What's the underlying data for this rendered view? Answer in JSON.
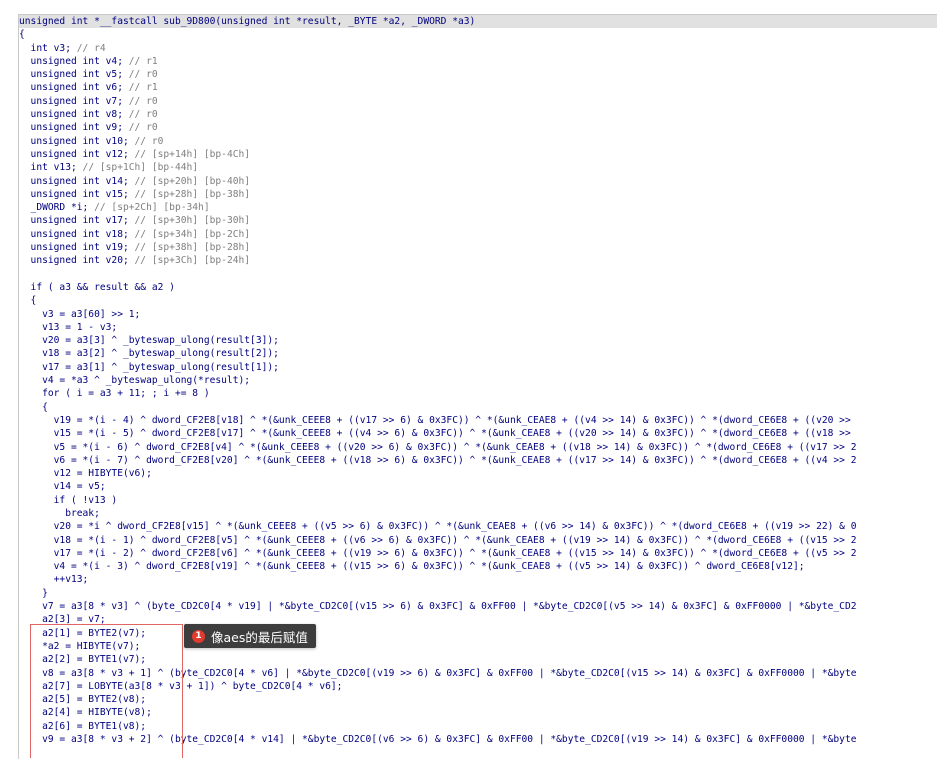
{
  "code": {
    "lines": [
      "unsigned int *__fastcall sub_9D800(unsigned int *result, _BYTE *a2, _DWORD *a3)",
      "{",
      "  int v3; // r4",
      "  unsigned int v4; // r1",
      "  unsigned int v5; // r0",
      "  unsigned int v6; // r1",
      "  unsigned int v7; // r0",
      "  unsigned int v8; // r0",
      "  unsigned int v9; // r0",
      "  unsigned int v10; // r0",
      "  unsigned int v12; // [sp+14h] [bp-4Ch]",
      "  int v13; // [sp+1Ch] [bp-44h]",
      "  unsigned int v14; // [sp+20h] [bp-40h]",
      "  unsigned int v15; // [sp+28h] [bp-38h]",
      "  _DWORD *i; // [sp+2Ch] [bp-34h]",
      "  unsigned int v17; // [sp+30h] [bp-30h]",
      "  unsigned int v18; // [sp+34h] [bp-2Ch]",
      "  unsigned int v19; // [sp+38h] [bp-28h]",
      "  unsigned int v20; // [sp+3Ch] [bp-24h]",
      "",
      "  if ( a3 && result && a2 )",
      "  {",
      "    v3 = a3[60] >> 1;",
      "    v13 = 1 - v3;",
      "    v20 = a3[3] ^ _byteswap_ulong(result[3]);",
      "    v18 = a3[2] ^ _byteswap_ulong(result[2]);",
      "    v17 = a3[1] ^ _byteswap_ulong(result[1]);",
      "    v4 = *a3 ^ _byteswap_ulong(*result);",
      "    for ( i = a3 + 11; ; i += 8 )",
      "    {",
      "      v19 = *(i - 4) ^ dword_CF2E8[v18] ^ *(&unk_CEEE8 + ((v17 >> 6) & 0x3FC)) ^ *(&unk_CEAE8 + ((v4 >> 14) & 0x3FC)) ^ *(dword_CE6E8 + ((v20 >>",
      "      v15 = *(i - 5) ^ dword_CF2E8[v17] ^ *(&unk_CEEE8 + ((v4 >> 6) & 0x3FC)) ^ *(&unk_CEAE8 + ((v20 >> 14) & 0x3FC)) ^ *(dword_CE6E8 + ((v18 >>",
      "      v5 = *(i - 6) ^ dword_CF2E8[v4] ^ *(&unk_CEEE8 + ((v20 >> 6) & 0x3FC)) ^ *(&unk_CEAE8 + ((v18 >> 14) & 0x3FC)) ^ *(dword_CE6E8 + ((v17 >> 2",
      "      v6 = *(i - 7) ^ dword_CF2E8[v20] ^ *(&unk_CEEE8 + ((v18 >> 6) & 0x3FC)) ^ *(&unk_CEAE8 + ((v17 >> 14) & 0x3FC)) ^ *(dword_CE6E8 + ((v4 >> 2",
      "      v12 = HIBYTE(v6);",
      "      v14 = v5;",
      "      if ( !v13 )",
      "        break;",
      "      v20 = *i ^ dword_CF2E8[v15] ^ *(&unk_CEEE8 + ((v5 >> 6) & 0x3FC)) ^ *(&unk_CEAE8 + ((v6 >> 14) & 0x3FC)) ^ *(dword_CE6E8 + ((v19 >> 22) & 0",
      "      v18 = *(i - 1) ^ dword_CF2E8[v5] ^ *(&unk_CEEE8 + ((v6 >> 6) & 0x3FC)) ^ *(&unk_CEAE8 + ((v19 >> 14) & 0x3FC)) ^ *(dword_CE6E8 + ((v15 >> 2",
      "      v17 = *(i - 2) ^ dword_CF2E8[v6] ^ *(&unk_CEEE8 + ((v19 >> 6) & 0x3FC)) ^ *(&unk_CEAE8 + ((v15 >> 14) & 0x3FC)) ^ *(dword_CE6E8 + ((v5 >> 2",
      "      v4 = *(i - 3) ^ dword_CF2E8[v19] ^ *(&unk_CEEE8 + ((v15 >> 6) & 0x3FC)) ^ *(&unk_CEAE8 + ((v5 >> 14) & 0x3FC)) ^ dword_CE6E8[v12];",
      "      ++v13;",
      "    }",
      "    v7 = a3[8 * v3] ^ (byte_CD2C0[4 * v19] | *&byte_CD2C0[(v15 >> 6) & 0x3FC] & 0xFF00 | *&byte_CD2C0[(v5 >> 14) & 0x3FC] & 0xFF0000 | *&byte_CD2",
      "    a2[3] = v7;",
      "    a2[1] = BYTE2(v7);",
      "    *a2 = HIBYTE(v7);",
      "    a2[2] = BYTE1(v7);",
      "    v8 = a3[8 * v3 + 1] ^ (byte_CD2C0[4 * v6] | *&byte_CD2C0[(v19 >> 6) & 0x3FC] & 0xFF00 | *&byte_CD2C0[(v15 >> 14) & 0x3FC] & 0xFF0000 | *&byte",
      "    a2[7] = LOBYTE(a3[8 * v3 + 1]) ^ byte_CD2C0[4 * v6];",
      "    a2[5] = BYTE2(v8);",
      "    a2[4] = HIBYTE(v8);",
      "    a2[6] = BYTE1(v8);",
      "    v9 = a3[8 * v3 + 2] ^ (byte_CD2C0[4 * v14] | *&byte_CD2C0[(v6 >> 6) & 0x3FC] & 0xFF00 | *&byte_CD2C0[(v19 >> 14) & 0x3FC] & 0xFF0000 | *&byte"
    ]
  },
  "annotation": {
    "number": "1",
    "text": "像aes的最后赋值"
  }
}
